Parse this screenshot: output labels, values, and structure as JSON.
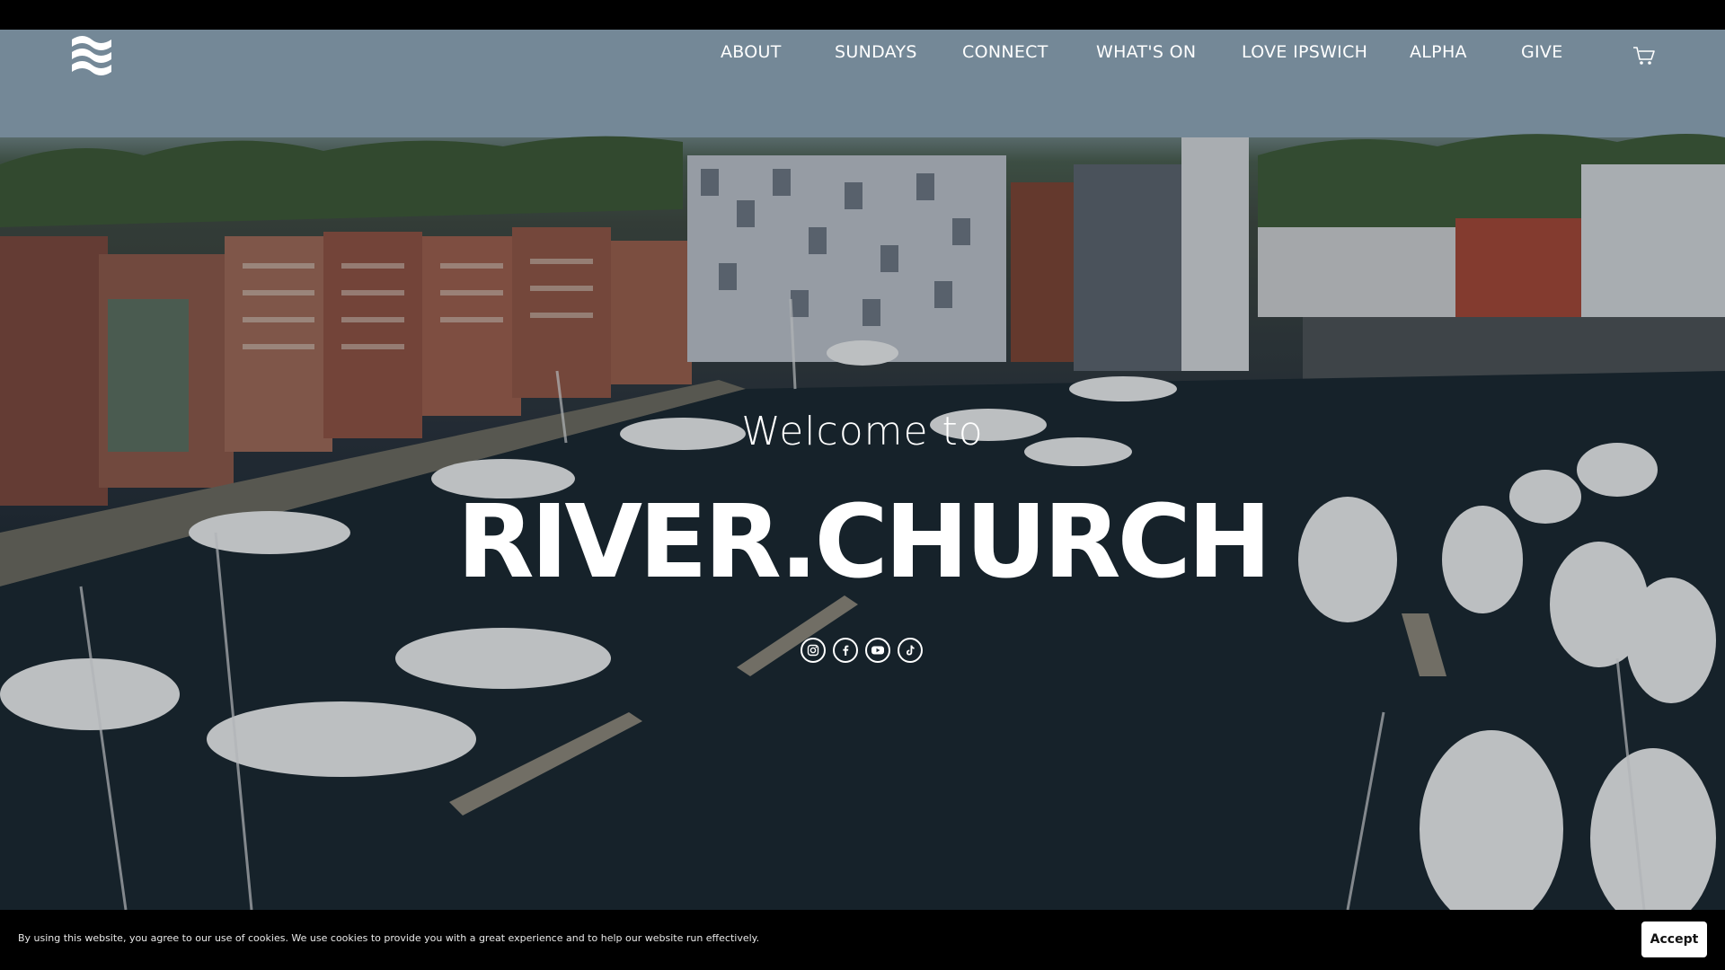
{
  "header": {
    "nav": [
      "ABOUT",
      "SUNDAYS",
      "CONNECT",
      "WHAT'S ON",
      "LOVE IPSWICH",
      "ALPHA",
      "GIVE"
    ],
    "logo_icon": "river-waves-logo",
    "cart_icon": "cart-icon"
  },
  "hero": {
    "welcome": "Welcome to",
    "brand": "RIVER.CHURCH",
    "socials": [
      "instagram-icon",
      "facebook-icon",
      "youtube-icon",
      "tiktok-icon"
    ]
  },
  "cookie_banner": {
    "text": "By using this website, you agree to our use of cookies. We use cookies to provide you with a great experience and to help our website run effectively.",
    "accept_label": "Accept"
  },
  "colors": {
    "top_bar": "#000000",
    "text": "#ffffff",
    "cookie_bg": "#000000",
    "button_bg": "#ffffff"
  }
}
